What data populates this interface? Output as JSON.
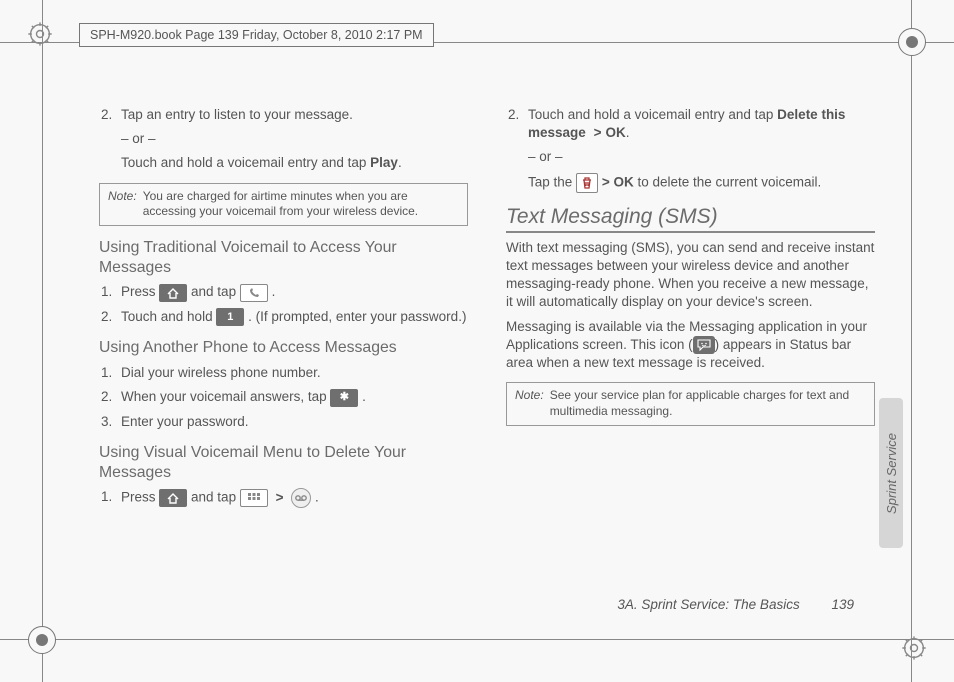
{
  "header": {
    "crop_info": "SPH-M920.book  Page 139  Friday, October 8, 2010  2:17 PM"
  },
  "left": {
    "step2": "Tap an entry to listen to your message.",
    "or": "– or –",
    "step2b_pre": "Touch and hold a voicemail entry and tap ",
    "step2b_bold": "Play",
    "note1_label": "Note:",
    "note1": "You are charged for airtime minutes when you are accessing your voicemail from your wireless device.",
    "h_trad": "Using Traditional Voicemail to Access Your Messages",
    "t1_pre": "Press ",
    "t1_mid": " and tap ",
    "t2_pre": "Touch and hold ",
    "t2_post": ". (If prompted, enter your password.)",
    "h_another": "Using Another Phone to Access Messages",
    "a1": "Dial your wireless phone number.",
    "a2_pre": "When your voicemail answers, tap ",
    "a3": "Enter your password.",
    "h_visual": "Using Visual Voicemail Menu to Delete Your Messages",
    "v1_pre": "Press ",
    "v1_mid": " and tap ",
    "numbers": {
      "n1": "1.",
      "n2": "2.",
      "n3": "3."
    }
  },
  "right": {
    "r2_pre": "Touch and hold a voicemail entry and tap ",
    "r2_bold": "Delete this message",
    "r2_gt": ">",
    "r2_ok": "OK",
    "or": "– or –",
    "r2b_pre": "Tap the ",
    "r2b_mid": " > ",
    "r2b_ok": "OK",
    "r2b_post": " to delete the current voicemail.",
    "h_sms": "Text Messaging (SMS)",
    "p1": "With text messaging (SMS), you can send and receive instant text messages between your wireless device and another messaging-ready phone. When you receive a new message, it will automatically display on your device's screen.",
    "p2a": "Messaging is available via the Messaging application in your Applications screen. This icon (",
    "p2b": ") appears in Status bar area when a new text message is received.",
    "note2_label": "Note:",
    "note2": "See your service plan for applicable charges for text and multimedia messaging."
  },
  "side_tab": "Sprint Service",
  "footer": {
    "section": "3A. Sprint Service: The Basics",
    "page": "139"
  },
  "icons": {
    "home": "home-icon",
    "phone": "phone-icon",
    "key1": "1",
    "star": "✱",
    "grid": "grid-icon",
    "voicemail": "voicemail-icon",
    "trash": "trash-icon",
    "msg": "msg-icon"
  }
}
